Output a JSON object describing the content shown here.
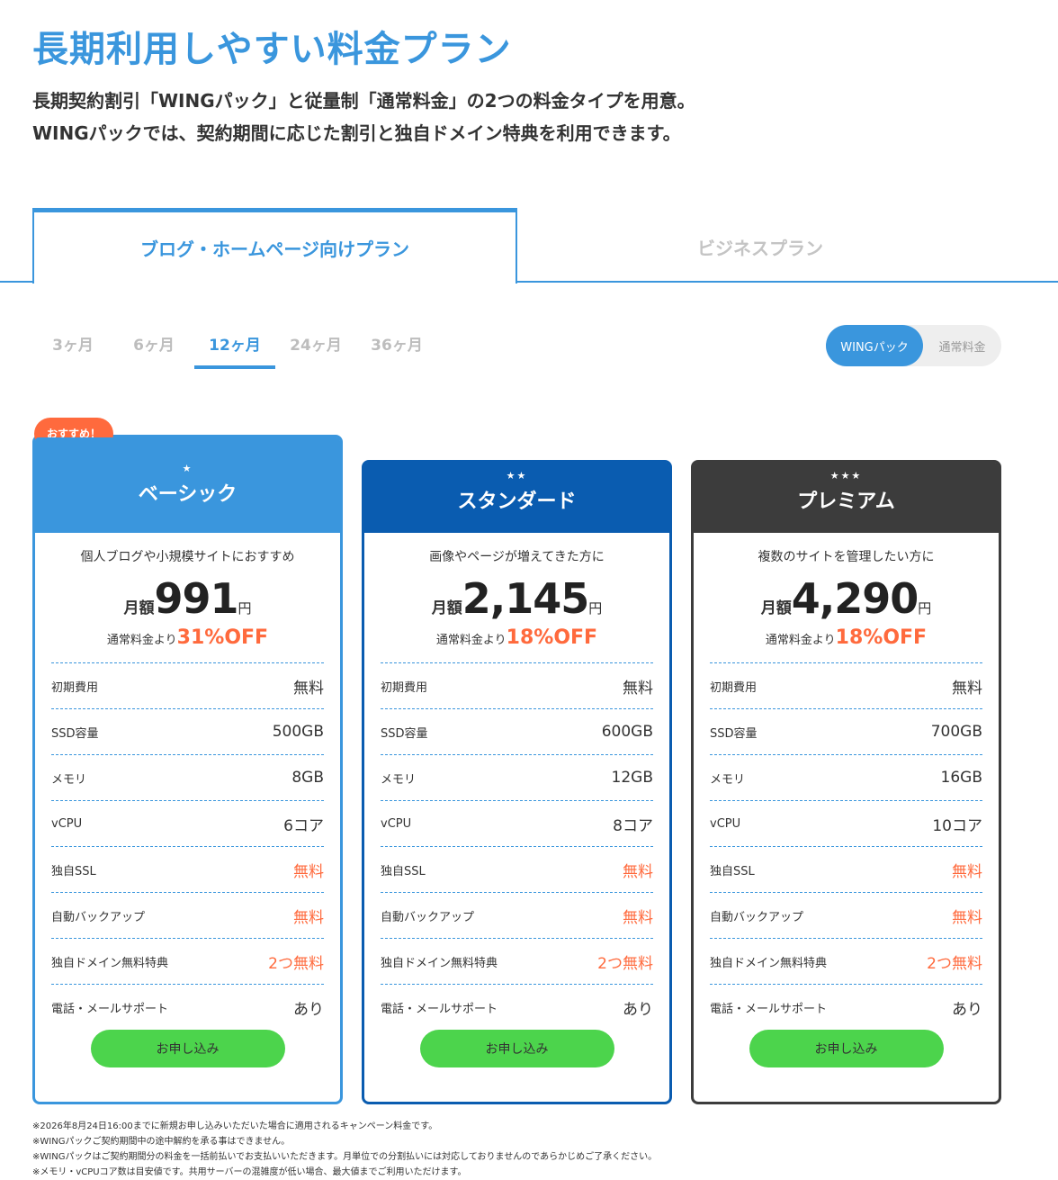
{
  "header": {
    "title": "長期利用しやすい料金プラン",
    "lead_line1": "長期契約割引「WINGパック」と従量制「通常料金」の2つの料金タイプを用意。",
    "lead_line2": "WINGパックでは、契約期間に応じた割引と独自ドメイン特典を利用できます。"
  },
  "tabs": {
    "active": "ブログ・ホームページ向けプラン",
    "inactive": "ビジネスプラン"
  },
  "periods": [
    "3ヶ月",
    "6ヶ月",
    "12ヶ月",
    "24ヶ月",
    "36ヶ月"
  ],
  "toggle": {
    "on": "WINGパック",
    "off": "通常料金"
  },
  "colors": {
    "blue": "#3a96dd",
    "navy": "#0a5cb0",
    "dark": "#3c3c3c",
    "orange": "#ff6a3d",
    "green": "#4cd44c"
  },
  "spec_labels": [
    "初期費用",
    "SSD容量",
    "メモリ",
    "vCPU",
    "独自SSL",
    "自動バックアップ",
    "独自ドメイン無料特典",
    "電話・メールサポート"
  ],
  "cards": [
    {
      "badge": "おすすめ！",
      "stars": "★",
      "name": "ベーシック",
      "tagline": "個人ブログや小規模サイトにおすすめ",
      "price_prefix": "月額",
      "price": "991",
      "price_unit": "円",
      "discount_text": "通常料金より",
      "discount": "31%OFF",
      "specs": [
        "無料",
        "500GB",
        "8GB",
        "6コア",
        "無料",
        "無料",
        "2つ無料",
        "あり"
      ],
      "apply": "お申し込み"
    },
    {
      "stars": "★★",
      "name": "スタンダード",
      "tagline": "画像やページが増えてきた方に",
      "price_prefix": "月額",
      "price": "2,145",
      "price_unit": "円",
      "discount_text": "通常料金より",
      "discount": "18%OFF",
      "specs": [
        "無料",
        "600GB",
        "12GB",
        "8コア",
        "無料",
        "無料",
        "2つ無料",
        "あり"
      ],
      "apply": "お申し込み"
    },
    {
      "stars": "★★★",
      "name": "プレミアム",
      "tagline": "複数のサイトを管理したい方に",
      "price_prefix": "月額",
      "price": "4,290",
      "price_unit": "円",
      "discount_text": "通常料金より",
      "discount": "18%OFF",
      "specs": [
        "無料",
        "700GB",
        "16GB",
        "10コア",
        "無料",
        "無料",
        "2つ無料",
        "あり"
      ],
      "apply": "お申し込み"
    }
  ],
  "notes": [
    "※2026年8月24日16:00までに新規お申し込みいただいた場合に適用されるキャンペーン料金です。",
    "※WINGパックご契約期間中の途中解約を承る事はできません。",
    "※WINGパックはご契約期間分の料金を一括前払いでお支払いいただきます。月単位での分割払いには対応しておりませんのであらかじめご了承ください。",
    "※メモリ・vCPUコア数は目安値です。共用サーバーの混雑度が低い場合、最大値までご利用いただけます。"
  ]
}
